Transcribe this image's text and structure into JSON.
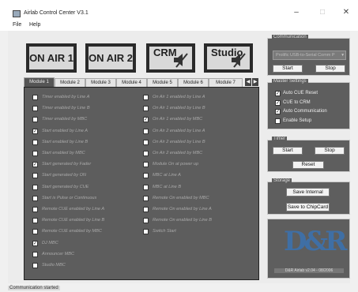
{
  "window": {
    "title": "Airlab Control Center V3.1",
    "minimize": "–",
    "maximize": "□",
    "close": "✕"
  },
  "menu": [
    "File",
    "Help"
  ],
  "top_buttons": [
    {
      "label": "ON AIR 1",
      "speaker": false
    },
    {
      "label": "ON AIR 2",
      "speaker": false
    },
    {
      "label": "CRM",
      "speaker": true
    },
    {
      "label": "Studio",
      "speaker": true
    }
  ],
  "tabs": [
    "Module 1",
    "Module 2",
    "Module 3",
    "Module 4",
    "Module 5",
    "Module 6",
    "Module 7"
  ],
  "active_tab": "Module 1",
  "options_left": [
    {
      "label": "Timer enabled by Line A",
      "checked": false
    },
    {
      "label": "Timer enabled by Line B",
      "checked": false
    },
    {
      "label": "Timer enabled by MBC",
      "checked": false
    },
    {
      "label": "Start enabled by Line A",
      "checked": true
    },
    {
      "label": "Start enabled by Line B",
      "checked": false
    },
    {
      "label": "Start enabled by MBC",
      "checked": false
    },
    {
      "label": "Start generated by Fader",
      "checked": true
    },
    {
      "label": "Start generated by ON",
      "checked": false
    },
    {
      "label": "Start generated by CUE",
      "checked": false
    },
    {
      "label": "Start is Pulse or Continuous",
      "checked": false
    },
    {
      "label": "Remote CUE enabled by Line A",
      "checked": false
    },
    {
      "label": "Remote CUE enabled by Line B",
      "checked": false
    },
    {
      "label": "Remote CUE enabled by MBC",
      "checked": false
    },
    {
      "label": "DJ MBC",
      "checked": true
    },
    {
      "label": "Announcer MBC",
      "checked": false
    },
    {
      "label": "Studio MBC",
      "checked": false
    }
  ],
  "options_right": [
    {
      "label": "On Air 1 enabled by Line A",
      "checked": false
    },
    {
      "label": "On Air 1 enabled by Line B",
      "checked": false
    },
    {
      "label": "On Air 1 enabled by MBC",
      "checked": true
    },
    {
      "label": "On Air 2 enabled by Line A",
      "checked": false
    },
    {
      "label": "On Air 2 enabled by Line B",
      "checked": false
    },
    {
      "label": "On Air 2 enabled by MBC",
      "checked": false
    },
    {
      "label": "Module On at power up",
      "checked": false
    },
    {
      "label": "MBC at Line A",
      "checked": false
    },
    {
      "label": "MBC at Line B",
      "checked": false
    },
    {
      "label": "Remote On enabled by MBC",
      "checked": false
    },
    {
      "label": "Remote On enabled by Line A",
      "checked": false
    },
    {
      "label": "Remote On enabled by Line B",
      "checked": false
    },
    {
      "label": "Switch Start",
      "checked": false
    }
  ],
  "communication": {
    "title": "Communication",
    "port": "Prolific USB-to-Serial Comm P",
    "start": "Start",
    "stop": "Stop"
  },
  "master_settings": {
    "title": "Master Settings",
    "options": [
      {
        "label": "Auto CUE Reset",
        "checked": true
      },
      {
        "label": "CUE to CRM",
        "checked": true
      },
      {
        "label": "Auto Communication",
        "checked": true
      },
      {
        "label": "Enable Setup",
        "checked": false
      }
    ]
  },
  "timer": {
    "title": "Timer",
    "start": "Start",
    "stop": "Stop",
    "reset": "Reset"
  },
  "storage": {
    "title": "Storage",
    "save_internal": "Save Internal",
    "save_chipcard": "Save to ChipCard"
  },
  "logo": {
    "text": "D&R",
    "caption": "D&R Airlab v2.04 - 08/2006"
  },
  "status": "Communication started",
  "colors": {
    "panel": "#5d5d5d",
    "logo_blue": "#3f6fa5"
  }
}
